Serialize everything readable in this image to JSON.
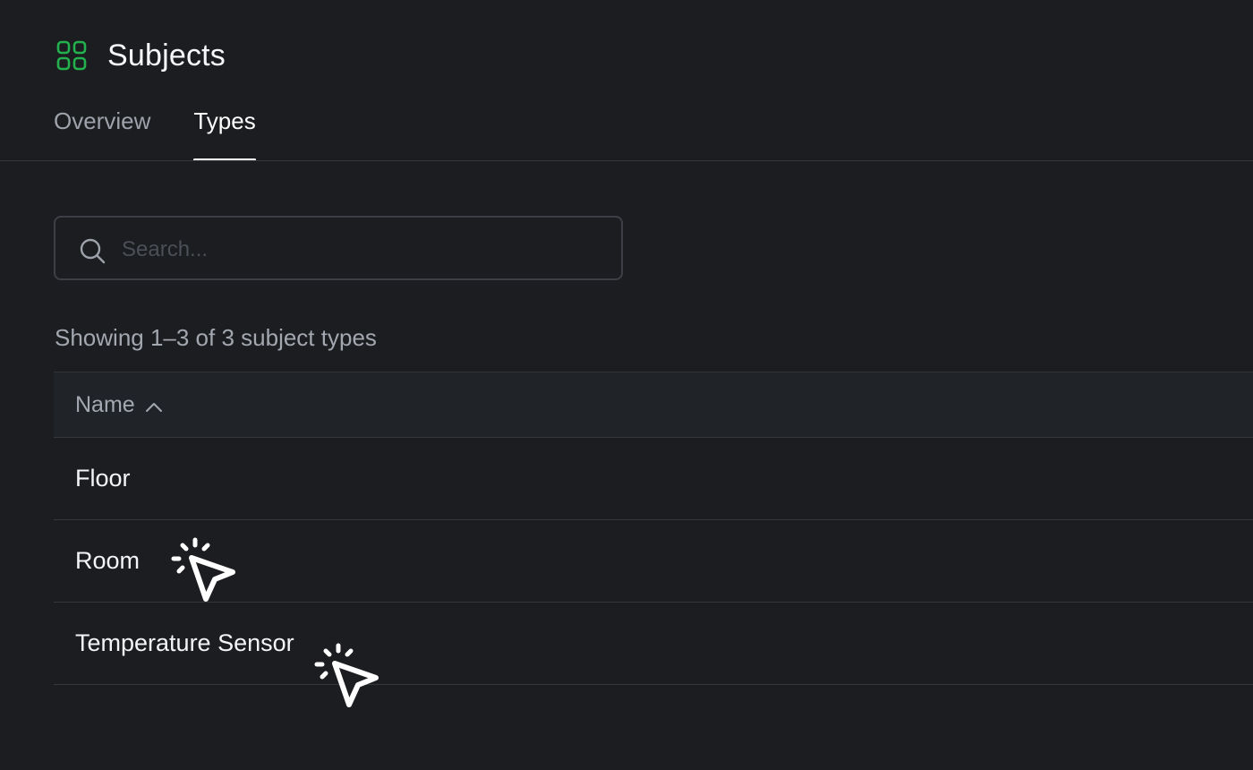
{
  "header": {
    "title": "Subjects",
    "icon": "subjects-grid-icon",
    "accent_color": "#22b14c"
  },
  "tabs": [
    {
      "label": "Overview",
      "active": false
    },
    {
      "label": "Types",
      "active": true
    }
  ],
  "search": {
    "placeholder": "Search...",
    "value": ""
  },
  "results": {
    "summary": "Showing 1–3 of 3 subject types"
  },
  "table": {
    "columns": [
      {
        "label": "Name",
        "sort": "ascending"
      }
    ],
    "rows": [
      {
        "name": "Floor"
      },
      {
        "name": "Room"
      },
      {
        "name": "Temperature Sensor"
      }
    ]
  }
}
